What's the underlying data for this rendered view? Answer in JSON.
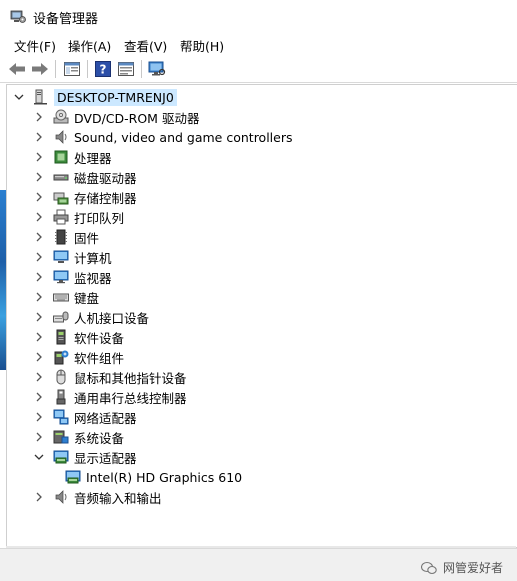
{
  "window": {
    "title": "设备管理器"
  },
  "menu": {
    "file": "文件(F)",
    "action": "操作(A)",
    "view": "查看(V)",
    "help": "帮助(H)"
  },
  "tree": {
    "root": "DESKTOP-TMRENJ0",
    "categories": [
      {
        "label": "DVD/CD-ROM 驱动器",
        "icon": "dvd-drive-icon"
      },
      {
        "label": "Sound, video and game controllers",
        "icon": "speaker-icon"
      },
      {
        "label": "处理器",
        "icon": "processor-icon"
      },
      {
        "label": "磁盘驱动器",
        "icon": "disk-drive-icon"
      },
      {
        "label": "存储控制器",
        "icon": "storage-controller-icon"
      },
      {
        "label": "打印队列",
        "icon": "printer-icon"
      },
      {
        "label": "固件",
        "icon": "firmware-icon"
      },
      {
        "label": "计算机",
        "icon": "computer-icon"
      },
      {
        "label": "监视器",
        "icon": "monitor-icon"
      },
      {
        "label": "键盘",
        "icon": "keyboard-icon"
      },
      {
        "label": "人机接口设备",
        "icon": "hid-icon"
      },
      {
        "label": "软件设备",
        "icon": "software-device-icon"
      },
      {
        "label": "软件组件",
        "icon": "software-component-icon"
      },
      {
        "label": "鼠标和其他指针设备",
        "icon": "mouse-icon"
      },
      {
        "label": "通用串行总线控制器",
        "icon": "usb-icon"
      },
      {
        "label": "网络适配器",
        "icon": "network-adapter-icon"
      },
      {
        "label": "系统设备",
        "icon": "system-device-icon"
      },
      {
        "label": "显示适配器",
        "icon": "display-adapter-icon",
        "expanded": true
      },
      {
        "label": "Intel(R) HD Graphics 610",
        "icon": "display-adapter-icon",
        "child": true
      },
      {
        "label": "音频输入和输出",
        "icon": "speaker-icon"
      }
    ]
  },
  "watermark": {
    "text": "网管爱好者"
  },
  "colors": {
    "selection": "#cce8ff",
    "accent": "#1e78d2"
  }
}
